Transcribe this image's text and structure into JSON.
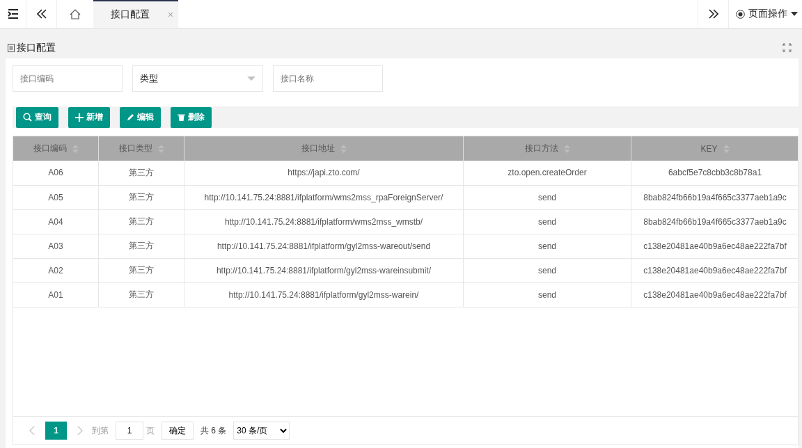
{
  "tabs": [
    {
      "label": "接口配置",
      "selected": true,
      "close": "×"
    }
  ],
  "page_actions": {
    "label": "页面操作"
  },
  "panel": {
    "title": "接口配置"
  },
  "filters": [
    {
      "kind": "text",
      "placeholder": "接口编码"
    },
    {
      "kind": "select",
      "value": "类型"
    },
    {
      "kind": "text",
      "placeholder": "接口名称"
    }
  ],
  "toolbar": [
    {
      "kind": "search",
      "label": "查询"
    },
    {
      "kind": "add",
      "label": "新增"
    },
    {
      "kind": "edit",
      "label": "编辑"
    },
    {
      "kind": "delete",
      "label": "删除"
    }
  ],
  "table": {
    "columns": [
      "接口编码",
      "接口类型",
      "接口地址",
      "接口方法",
      "KEY"
    ],
    "rows": [
      [
        "A06",
        "第三方",
        "https://japi.zto.com/",
        "zto.open.createOrder",
        "6abcf5e7c8cbb3c8b78a1"
      ],
      [
        "A05",
        "第三方",
        "http://10.141.75.24:8881/ifplatform/wms2mss_rpaForeignServer/",
        "send",
        "8bab824fb66b19a4f665c3377aeb1a9c"
      ],
      [
        "A04",
        "第三方",
        "http://10.141.75.24:8881/ifplatform/wms2mss_wmstb/",
        "send",
        "8bab824fb66b19a4f665c3377aeb1a9c"
      ],
      [
        "A03",
        "第三方",
        "http://10.141.75.24:8881/ifplatform/gyl2mss-wareout/send",
        "send",
        "c138e20481ae40b9a6ec48ae222fa7bf"
      ],
      [
        "A02",
        "第三方",
        "http://10.141.75.24:8881/ifplatform/gyl2mss-wareinsubmit/",
        "send",
        "c138e20481ae40b9a6ec48ae222fa7bf"
      ],
      [
        "A01",
        "第三方",
        "http://10.141.75.24:8881/ifplatform/gyl2mss-warein/",
        "send",
        "c138e20481ae40b9a6ec48ae222fa7bf"
      ]
    ]
  },
  "pagination": {
    "pages": [
      {
        "label": "1",
        "selected": true
      }
    ],
    "goto_label": "到第",
    "goto_value": "1",
    "page_unit": "页",
    "confirm": "确定",
    "total": "共 6 条",
    "page_size": "30 条/页"
  }
}
